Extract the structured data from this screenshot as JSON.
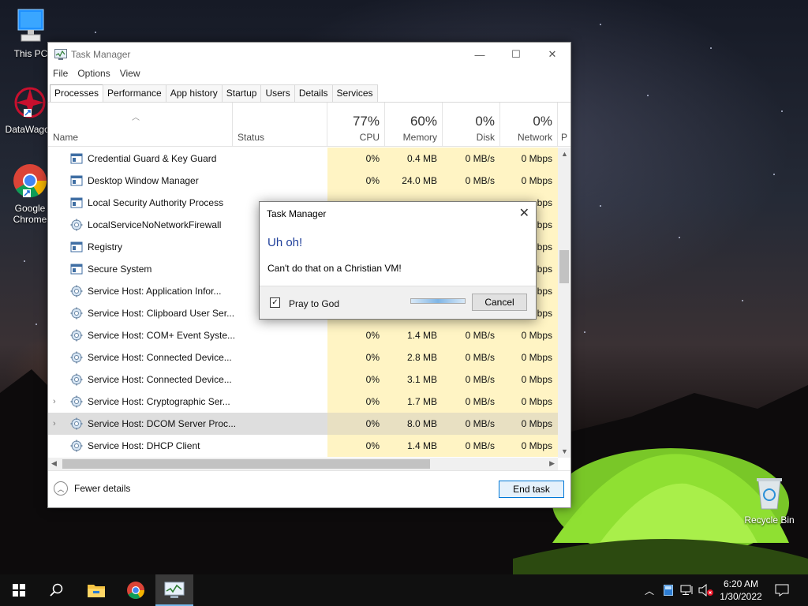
{
  "desktop": {
    "icons": [
      {
        "label": "This PC"
      },
      {
        "label": "DataWagon"
      },
      {
        "label": "Google Chrome"
      },
      {
        "label": "Recycle Bin"
      }
    ]
  },
  "window": {
    "title": "Task Manager",
    "controls": {
      "minimize": "—",
      "maximize": "☐",
      "close": "✕"
    },
    "menu": [
      "File",
      "Options",
      "View"
    ],
    "tabs": [
      "Processes",
      "Performance",
      "App history",
      "Startup",
      "Users",
      "Details",
      "Services"
    ],
    "active_tab": "Processes",
    "columns": {
      "name": "Name",
      "status": "Status",
      "cpu": {
        "percent": "77%",
        "label": "CPU"
      },
      "memory": {
        "percent": "60%",
        "label": "Memory"
      },
      "disk": {
        "percent": "0%",
        "label": "Disk"
      },
      "network": {
        "percent": "0%",
        "label": "Network"
      },
      "power_cut": "P"
    },
    "processes": [
      {
        "name": "Credential Guard & Key Guard",
        "icon": "window-icon",
        "cpu": "0%",
        "memory": "0.4 MB",
        "disk": "0 MB/s",
        "network": "0 Mbps",
        "expandable": false
      },
      {
        "name": "Desktop Window Manager",
        "icon": "window-icon",
        "cpu": "0%",
        "memory": "24.0 MB",
        "disk": "0 MB/s",
        "network": "0 Mbps",
        "expandable": false
      },
      {
        "name": "Local Security Authority Process",
        "icon": "window-icon",
        "cpu": "",
        "memory": "",
        "disk": "",
        "network": "bps",
        "expandable": false
      },
      {
        "name": "LocalServiceNoNetworkFirewall",
        "icon": "gear-icon",
        "cpu": "",
        "memory": "",
        "disk": "",
        "network": "bps",
        "expandable": false
      },
      {
        "name": "Registry",
        "icon": "window-icon",
        "cpu": "",
        "memory": "",
        "disk": "",
        "network": "bps",
        "expandable": false
      },
      {
        "name": "Secure System",
        "icon": "window-icon",
        "cpu": "",
        "memory": "",
        "disk": "",
        "network": "bps",
        "expandable": false
      },
      {
        "name": "Service Host: Application Infor...",
        "icon": "gear-icon",
        "cpu": "",
        "memory": "",
        "disk": "",
        "network": "bps",
        "expandable": false
      },
      {
        "name": "Service Host: Clipboard User Ser...",
        "icon": "gear-icon",
        "cpu": "",
        "memory": "",
        "disk": "",
        "network": "bps",
        "expandable": false
      },
      {
        "name": "Service Host: COM+ Event Syste...",
        "icon": "gear-icon",
        "cpu": "0%",
        "memory": "1.4 MB",
        "disk": "0 MB/s",
        "network": "0 Mbps",
        "expandable": false
      },
      {
        "name": "Service Host: Connected Device...",
        "icon": "gear-icon",
        "cpu": "0%",
        "memory": "2.8 MB",
        "disk": "0 MB/s",
        "network": "0 Mbps",
        "expandable": false
      },
      {
        "name": "Service Host: Connected Device...",
        "icon": "gear-icon",
        "cpu": "0%",
        "memory": "3.1 MB",
        "disk": "0 MB/s",
        "network": "0 Mbps",
        "expandable": false
      },
      {
        "name": "Service Host: Cryptographic Ser...",
        "icon": "gear-icon",
        "cpu": "0%",
        "memory": "1.7 MB",
        "disk": "0 MB/s",
        "network": "0 Mbps",
        "expandable": true
      },
      {
        "name": "Service Host: DCOM Server Proc...",
        "icon": "gear-icon",
        "cpu": "0%",
        "memory": "8.0 MB",
        "disk": "0 MB/s",
        "network": "0 Mbps",
        "expandable": true,
        "selected": true
      },
      {
        "name": "Service Host: DHCP Client",
        "icon": "gear-icon",
        "cpu": "0%",
        "memory": "1.4 MB",
        "disk": "0 MB/s",
        "network": "0 Mbps",
        "expandable": false
      }
    ],
    "footer": {
      "fewer_details": "Fewer details",
      "end_task": "End task"
    }
  },
  "dialog": {
    "title": "Task Manager",
    "close": "✕",
    "heading": "Uh oh!",
    "message": "Can't do that on a Christian VM!",
    "checkbox_label": "Pray to God",
    "checkbox_checked": true,
    "checkbox_mark": "✓",
    "cancel": "Cancel"
  },
  "taskbar": {
    "time": "6:20 AM",
    "date": "1/30/2022",
    "apps": [
      "start-icon",
      "search-icon",
      "file-explorer-icon",
      "chrome-icon",
      "task-manager-icon"
    ]
  },
  "colors": {
    "accent": "#0078d7",
    "heat": "#fff4c4",
    "dialog_heading": "#1f3f9a"
  }
}
